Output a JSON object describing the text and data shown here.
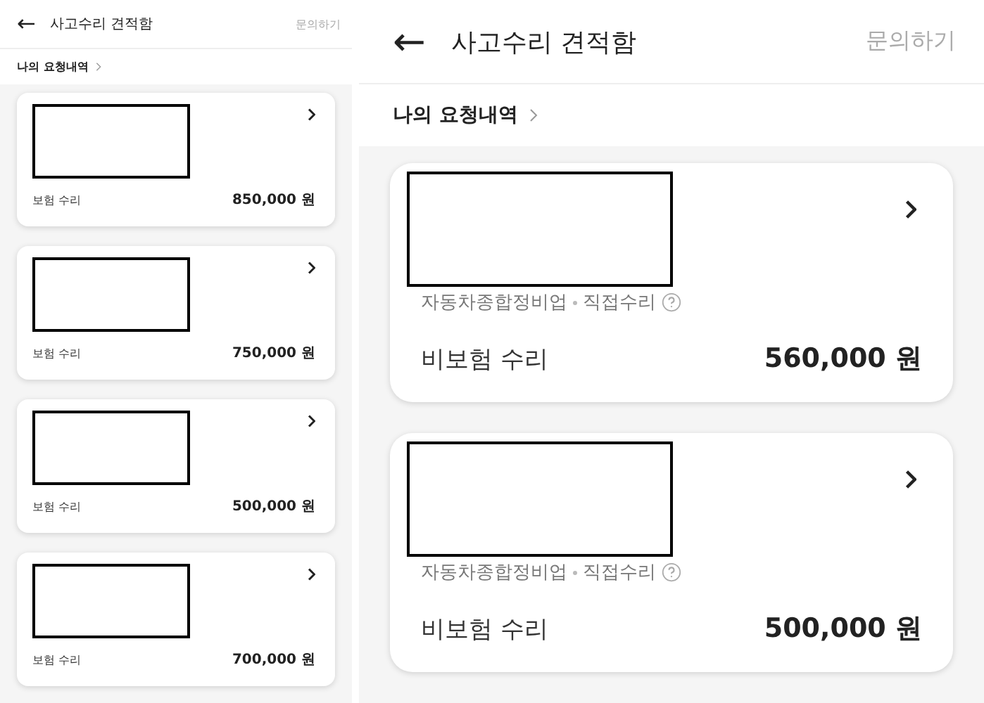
{
  "panels": [
    {
      "header": {
        "back": "←",
        "title": "사고수리 견적함",
        "action": "문의하기"
      },
      "section_link": "나의 요청내역",
      "cards": [
        {
          "repair_type": "보험 수리",
          "price": "850,000 원"
        },
        {
          "repair_type": "보험 수리",
          "price": "750,000 원"
        },
        {
          "repair_type": "보험 수리",
          "price": "500,000 원"
        },
        {
          "repair_type": "보험 수리",
          "price": "700,000 원"
        }
      ]
    },
    {
      "header": {
        "back": "←",
        "title": "사고수리 견적함",
        "action": "문의하기"
      },
      "section_link": "나의 요청내역",
      "cards": [
        {
          "shop_type": "자동차종합정비업",
          "repair_method": "직접수리",
          "repair_type": "비보험 수리",
          "price": "560,000 원"
        },
        {
          "shop_type": "자동차종합정비업",
          "repair_method": "직접수리",
          "repair_type": "비보험 수리",
          "price": "500,000 원"
        }
      ]
    }
  ]
}
